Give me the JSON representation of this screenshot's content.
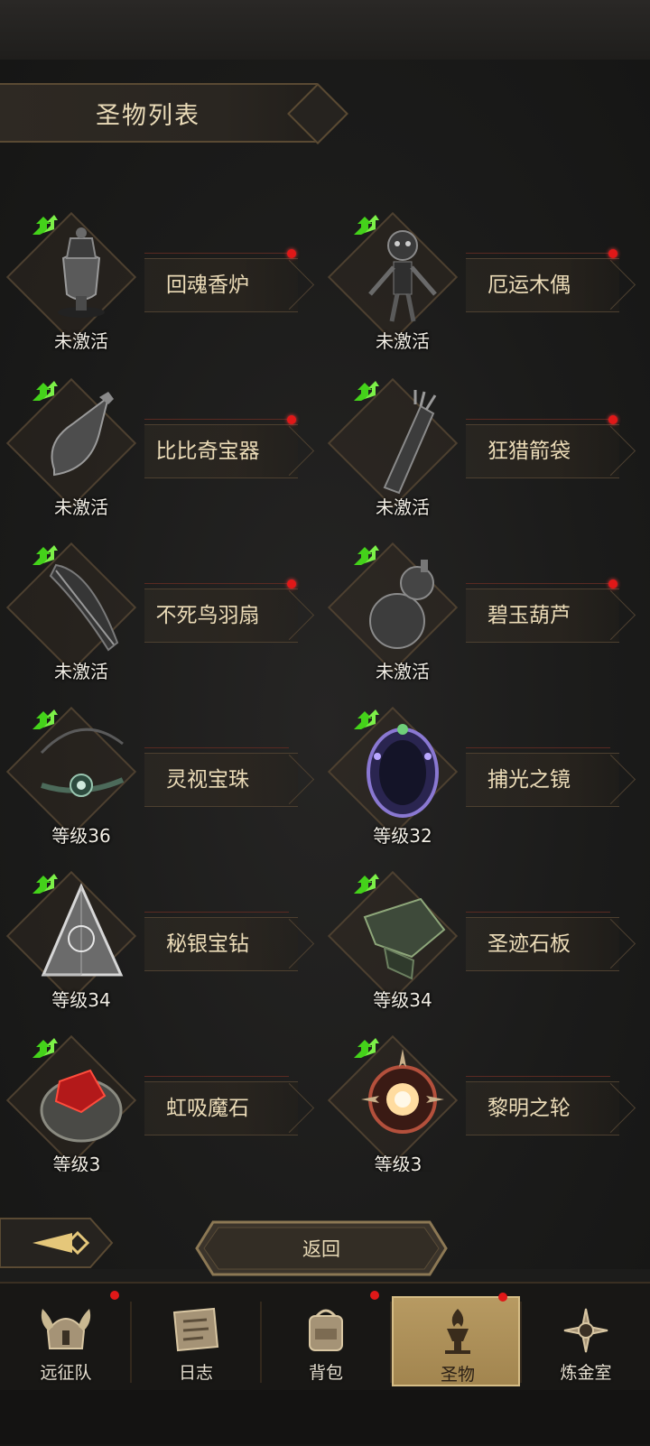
{
  "title": "圣物列表",
  "relics": [
    {
      "name": "回魂香炉",
      "status": "未激活",
      "badge": true,
      "art": "censer-icon"
    },
    {
      "name": "厄运木偶",
      "status": "未激活",
      "badge": true,
      "art": "puppet-icon"
    },
    {
      "name": "比比奇宝器",
      "status": "未激活",
      "badge": true,
      "art": "gourd-bomb-icon"
    },
    {
      "name": "狂猎箭袋",
      "status": "未激活",
      "badge": true,
      "art": "quiver-icon"
    },
    {
      "name": "不死鸟羽扇",
      "status": "未激活",
      "badge": true,
      "art": "feather-fan-icon"
    },
    {
      "name": "碧玉葫芦",
      "status": "未激活",
      "badge": true,
      "art": "gourd-icon"
    },
    {
      "name": "灵视宝珠",
      "status": "等级36",
      "badge": false,
      "art": "orb-necklace-icon"
    },
    {
      "name": "捕光之镜",
      "status": "等级32",
      "badge": false,
      "art": "mirror-icon"
    },
    {
      "name": "秘银宝钻",
      "status": "等级34",
      "badge": false,
      "art": "pyramid-gem-icon"
    },
    {
      "name": "圣迹石板",
      "status": "等级34",
      "badge": false,
      "art": "stone-tablet-icon"
    },
    {
      "name": "虹吸魔石",
      "status": "等级3_",
      "badge": false,
      "art": "red-crystal-icon"
    },
    {
      "name": "黎明之轮",
      "status": "等级3_",
      "badge": false,
      "art": "dawn-wheel-icon"
    }
  ],
  "buttons": {
    "return": "返回"
  },
  "tabs": [
    {
      "label": "远征队",
      "icon": "helmet-icon",
      "badge": true,
      "active": false
    },
    {
      "label": "日志",
      "icon": "scroll-icon",
      "badge": false,
      "active": false
    },
    {
      "label": "背包",
      "icon": "backpack-icon",
      "badge": true,
      "active": false
    },
    {
      "label": "圣物",
      "icon": "torch-relic-icon",
      "badge": true,
      "active": true
    },
    {
      "label": "炼金室",
      "icon": "alchemy-icon",
      "badge": false,
      "active": false
    }
  ],
  "colors": {
    "gold_text": "#eadbb8",
    "badge_red": "#e01818",
    "upgrade_green": "#44d21a",
    "active_tab": "#b79a62"
  }
}
